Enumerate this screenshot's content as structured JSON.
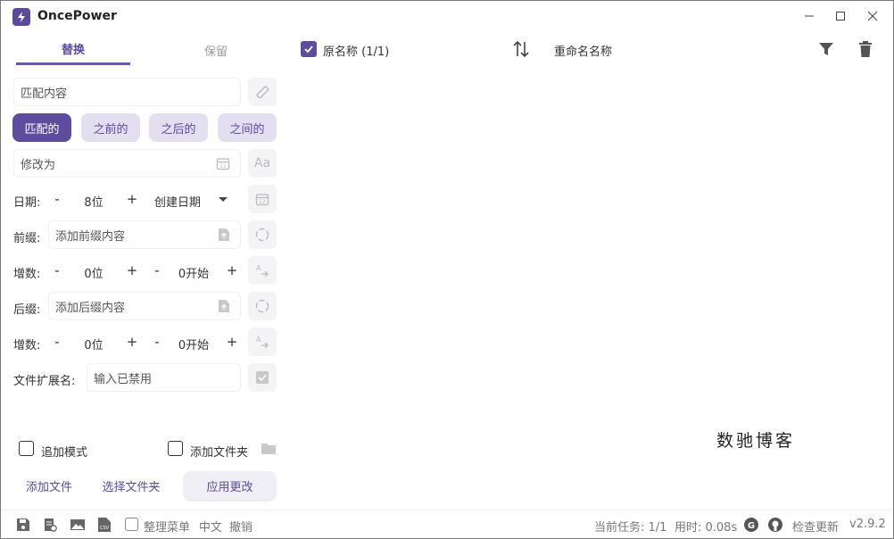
{
  "app": {
    "title": "OncePower"
  },
  "tabs": {
    "replace": "替换",
    "keep": "保留"
  },
  "match": {
    "placeholder": "匹配内容"
  },
  "modes": {
    "matched": "匹配的",
    "before": "之前的",
    "after": "之后的",
    "between": "之间的"
  },
  "modify": {
    "placeholder": "修改为"
  },
  "date": {
    "label": "日期:",
    "minus": "-",
    "plus": "+",
    "value": "8位",
    "type": "创建日期"
  },
  "prefix": {
    "label": "前缀:",
    "placeholder": "添加前缀内容"
  },
  "increment1": {
    "label": "增数:",
    "minus": "-",
    "plus": "+",
    "digits": "0位",
    "start": "0开始"
  },
  "suffix": {
    "label": "后缀:",
    "placeholder": "添加后缀内容"
  },
  "increment2": {
    "label": "增数:",
    "minus": "-",
    "plus": "+",
    "digits": "0位",
    "start": "0开始"
  },
  "extension": {
    "label": "文件扩展名:",
    "placeholder": "输入已禁用"
  },
  "options": {
    "append_mode": "追加模式",
    "add_folder": "添加文件夹"
  },
  "actions": {
    "add_file": "添加文件",
    "select_folder": "选择文件夹",
    "apply": "应用更改"
  },
  "list_header": {
    "original": "原名称 (1/1)",
    "renamed": "重命名名称"
  },
  "watermark": "数驰博客",
  "statusbar": {
    "organize_menu": "整理菜单",
    "language": "中文",
    "undo": "撤销",
    "current_task": "当前任务: 1/1",
    "elapsed": "用时: 0.08s",
    "check_update": "检查更新",
    "version": "v2.9.2"
  },
  "colors": {
    "accent": "#5e4d9f",
    "accent_light": "#e3dff0",
    "muted": "#9a9a9a"
  }
}
